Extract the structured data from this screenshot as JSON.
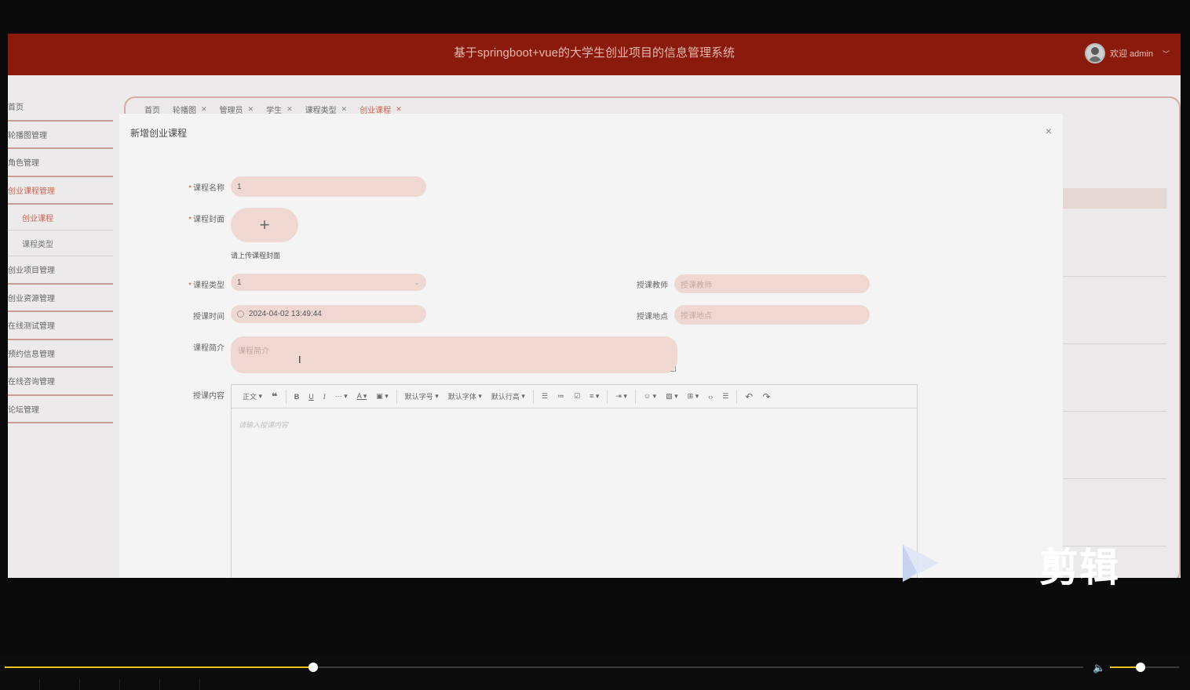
{
  "header": {
    "title": "基于springboot+vue的大学生创业项目的信息管理系统",
    "welcome": "欢迎 admin"
  },
  "sidebar": {
    "items": [
      {
        "label": "首页",
        "type": "item",
        "active": false
      },
      {
        "label": "轮播图管理",
        "type": "item",
        "active": false
      },
      {
        "label": "角色管理",
        "type": "item",
        "active": false
      },
      {
        "label": "创业课程管理",
        "type": "item",
        "active": true
      },
      {
        "label": "创业课程",
        "type": "sub",
        "active": true
      },
      {
        "label": "课程类型",
        "type": "sub",
        "active": false
      },
      {
        "label": "创业项目管理",
        "type": "item",
        "active": false
      },
      {
        "label": "创业资源管理",
        "type": "item",
        "active": false
      },
      {
        "label": "在线测试管理",
        "type": "item",
        "active": false
      },
      {
        "label": "预约信息管理",
        "type": "item",
        "active": false
      },
      {
        "label": "在线咨询管理",
        "type": "item",
        "active": false
      },
      {
        "label": "论坛管理",
        "type": "item",
        "active": false
      }
    ]
  },
  "tabs": [
    {
      "label": "首页",
      "closable": false,
      "active": false
    },
    {
      "label": "轮播图",
      "closable": true,
      "active": false
    },
    {
      "label": "管理员",
      "closable": true,
      "active": false
    },
    {
      "label": "学生",
      "closable": true,
      "active": false
    },
    {
      "label": "课程类型",
      "closable": true,
      "active": false
    },
    {
      "label": "创业课程",
      "closable": true,
      "active": true
    }
  ],
  "modal": {
    "title": "新增创业课程",
    "close": "×",
    "fields": {
      "course_name": {
        "label": "课程名称",
        "value": "1"
      },
      "cover": {
        "label": "课程封面",
        "plus": "+",
        "tip": "请上传课程封面"
      },
      "course_type": {
        "label": "课程类型",
        "value": "1"
      },
      "teacher": {
        "label": "授课教师",
        "placeholder": "授课教师"
      },
      "time": {
        "label": "授课时间",
        "value": "2024-04-02 13:49:44"
      },
      "place": {
        "label": "授课地点",
        "placeholder": "授课地点"
      },
      "intro": {
        "label": "课程简介",
        "placeholder": "课程简介"
      },
      "content": {
        "label": "授课内容",
        "placeholder": "请输入授课内容"
      }
    },
    "required_mark": "*"
  },
  "editor_toolbar": {
    "paragraph": "正文",
    "font_size": "默认字号",
    "font_family": "默认字体",
    "line_height": "默认行高"
  },
  "watermark": {
    "text": "剪辑"
  },
  "player": {
    "progress": 0.286,
    "volume": 0.44
  },
  "colors": {
    "header": "#8a1a0c",
    "accent": "#c26a5a",
    "input_bg": "#efd8d2",
    "progress": "#e8c21b"
  }
}
